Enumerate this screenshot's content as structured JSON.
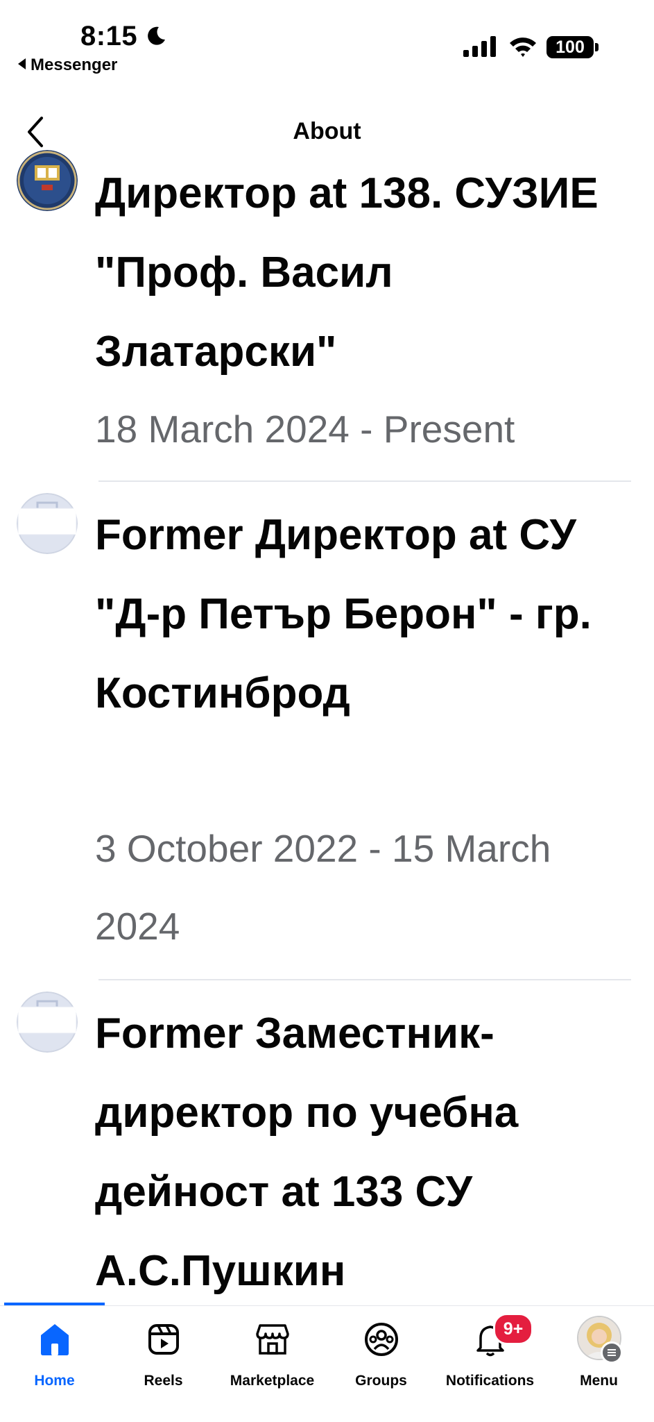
{
  "status_bar": {
    "time": "8:15",
    "back_app": "Messenger",
    "battery": "100"
  },
  "header": {
    "title": "About"
  },
  "jobs": [
    {
      "title": "Директор at 138. СУЗИЕ \"Проф. Васил Златарски\"",
      "dates": "18 March 2024 - Present",
      "icon": "school-logo-icon"
    },
    {
      "title": "Former Директор at СУ \"Д-р Петър Берон\" - гр. Костинброд",
      "dates": "3 October 2022 - 15 March 2024",
      "icon": "briefcase-icon"
    },
    {
      "title": "Former Заместник-директор по учебна дейност at 133 СУ А.С.Пушкин",
      "dates": "",
      "icon": "briefcase-icon"
    }
  ],
  "tabs": [
    {
      "label": "Home",
      "icon": "home-icon",
      "active": true
    },
    {
      "label": "Reels",
      "icon": "reels-icon",
      "active": false
    },
    {
      "label": "Marketplace",
      "icon": "marketplace-icon",
      "active": false
    },
    {
      "label": "Groups",
      "icon": "groups-icon",
      "active": false
    },
    {
      "label": "Notifications",
      "icon": "bell-icon",
      "active": false
    },
    {
      "label": "Menu",
      "icon": "avatar",
      "active": false
    }
  ],
  "notifications_badge": "9+",
  "colors": {
    "accent": "#0866ff",
    "badge": "#e41e3f",
    "secondary_text": "#65676b"
  }
}
